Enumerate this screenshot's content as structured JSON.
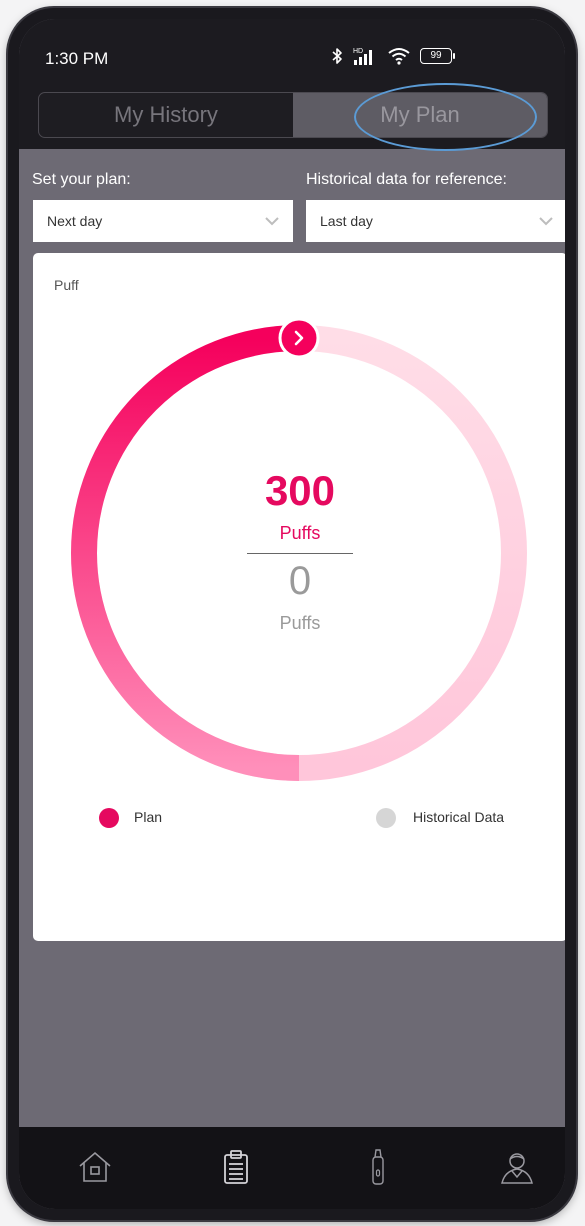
{
  "status_bar": {
    "time": "1:30 PM",
    "battery": "99",
    "icons": [
      "bluetooth-icon",
      "hd-signal-icon",
      "wifi-icon",
      "battery-icon"
    ]
  },
  "tabs": [
    {
      "label": "My History",
      "active": false
    },
    {
      "label": "My Plan",
      "active": true
    }
  ],
  "plan_select": {
    "label": "Set your plan:",
    "value": "Next day"
  },
  "history_select": {
    "label": "Historical data for reference:",
    "value": "Last day"
  },
  "card": {
    "title": "Puff",
    "plan_value": "300",
    "plan_unit": "Puffs",
    "historical_value": "0",
    "historical_unit": "Puffs",
    "plan_progress_fraction": 0.5
  },
  "legend": [
    {
      "label": "Plan",
      "color": "#e5095f"
    },
    {
      "label": "Historical Data",
      "color": "#d6d6d6"
    }
  ],
  "colors": {
    "accent": "#e5095f",
    "accent_light": "#ffd3e1",
    "background": "#6d6a74",
    "topbar": "#1c1b20"
  },
  "bottom_nav": [
    "home-icon",
    "clipboard-icon",
    "device-icon",
    "profile-icon"
  ]
}
